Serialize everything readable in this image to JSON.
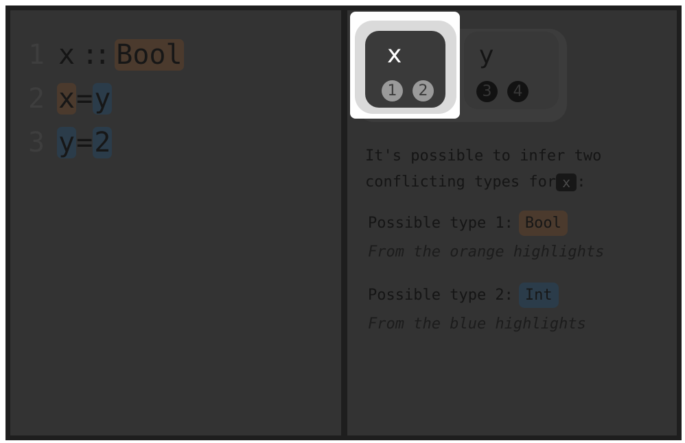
{
  "editor": {
    "lines": [
      {
        "number": "1",
        "tokens": [
          "x",
          "::",
          "Bool"
        ]
      },
      {
        "number": "2",
        "tokens": [
          "x",
          "=",
          "y"
        ]
      },
      {
        "number": "3",
        "tokens": [
          "y",
          "=",
          "2"
        ]
      }
    ]
  },
  "variables": [
    {
      "name": "x",
      "badges": [
        "1",
        "2"
      ],
      "selected": true
    },
    {
      "name": "y",
      "badges": [
        "3",
        "4"
      ],
      "selected": false
    }
  ],
  "explanation": {
    "line1": "It's possible to infer two",
    "line2": "conflicting types for",
    "variable": "x",
    "colon": ":"
  },
  "types": [
    {
      "label": "Possible type 1:",
      "value": "Bool",
      "note": "From the orange highlights",
      "color": "#4b3a2d"
    },
    {
      "label": "Possible type 2:",
      "value": "Int",
      "note": "From the blue highlights",
      "color": "#2b3c4a"
    }
  ]
}
